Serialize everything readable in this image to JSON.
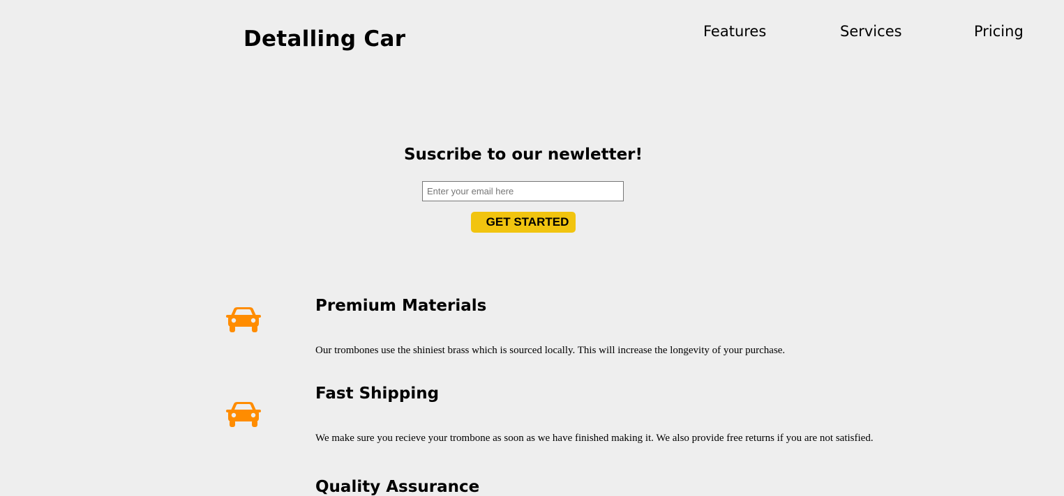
{
  "header": {
    "logo": "Detalling Car",
    "nav": [
      {
        "label": "Features"
      },
      {
        "label": "Services"
      },
      {
        "label": "Pricing"
      }
    ]
  },
  "signup": {
    "title": "Suscribe to our newletter!",
    "email_placeholder": "Enter your email here",
    "email_value": "",
    "button_label": "GET STARTED"
  },
  "features": [
    {
      "icon": "car-icon",
      "title": "Premium Materials",
      "description": "Our trombones use the shiniest brass which is sourced locally. This will increase the longevity of your purchase."
    },
    {
      "icon": "car-icon",
      "title": "Fast Shipping",
      "description": "We make sure you recieve your trombone as soon as we have finished making it. We also provide free returns if you are not satisfied."
    },
    {
      "title": "Quality Assurance"
    }
  ],
  "colors": {
    "background": "#eeeeee",
    "accent_button": "#f1c40f",
    "icon": "#ff8c00"
  }
}
